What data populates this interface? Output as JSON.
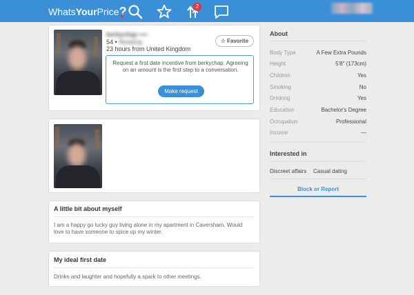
{
  "header": {
    "logo_prefix": "Whats",
    "logo_bold": "Your",
    "logo_suffix": "Price",
    "logo_mark": "?",
    "nav": [
      {
        "icon": "search-icon"
      },
      {
        "icon": "star-icon"
      },
      {
        "icon": "upgrade-arrows-icon",
        "badge": "2"
      },
      {
        "icon": "chat-icon"
      }
    ],
    "accent": "#3a8fd9"
  },
  "profile": {
    "age_line": "54 •",
    "location_line": "23 hours from United Kingdom",
    "favorite_label": "Favorite",
    "request": {
      "text": "Request a first date incentive from berkychap. Agreeing on an amount is the first step to a conversation.",
      "button_label": "Make request"
    }
  },
  "sections": {
    "about_myself_title": "A little bit about myself",
    "about_myself_text": "I am a happy go lucky guy living alone in my apartment in Caversham. Would love to have someone to spice up my winter.",
    "first_date_title": "My ideal first date",
    "first_date_text": "Drinks and laughter and hopefully a spark to other meetings."
  },
  "about": {
    "title": "About",
    "rows": [
      {
        "label": "Body Type",
        "value": "A Few Extra Pounds"
      },
      {
        "label": "Height",
        "value": "5'8\" (173cm)"
      },
      {
        "label": "Children",
        "value": "Yes"
      },
      {
        "label": "Smoking",
        "value": "No"
      },
      {
        "label": "Drinking",
        "value": "Yes"
      },
      {
        "label": "Education",
        "value": "Bachelor's Degree"
      },
      {
        "label": "Occupation",
        "value": "Professional"
      },
      {
        "label": "Income",
        "value": "—"
      }
    ],
    "interested_title": "Interested in",
    "interests": [
      "Discreet affairs",
      "Casual dating"
    ],
    "block_label": "Block or Report"
  }
}
